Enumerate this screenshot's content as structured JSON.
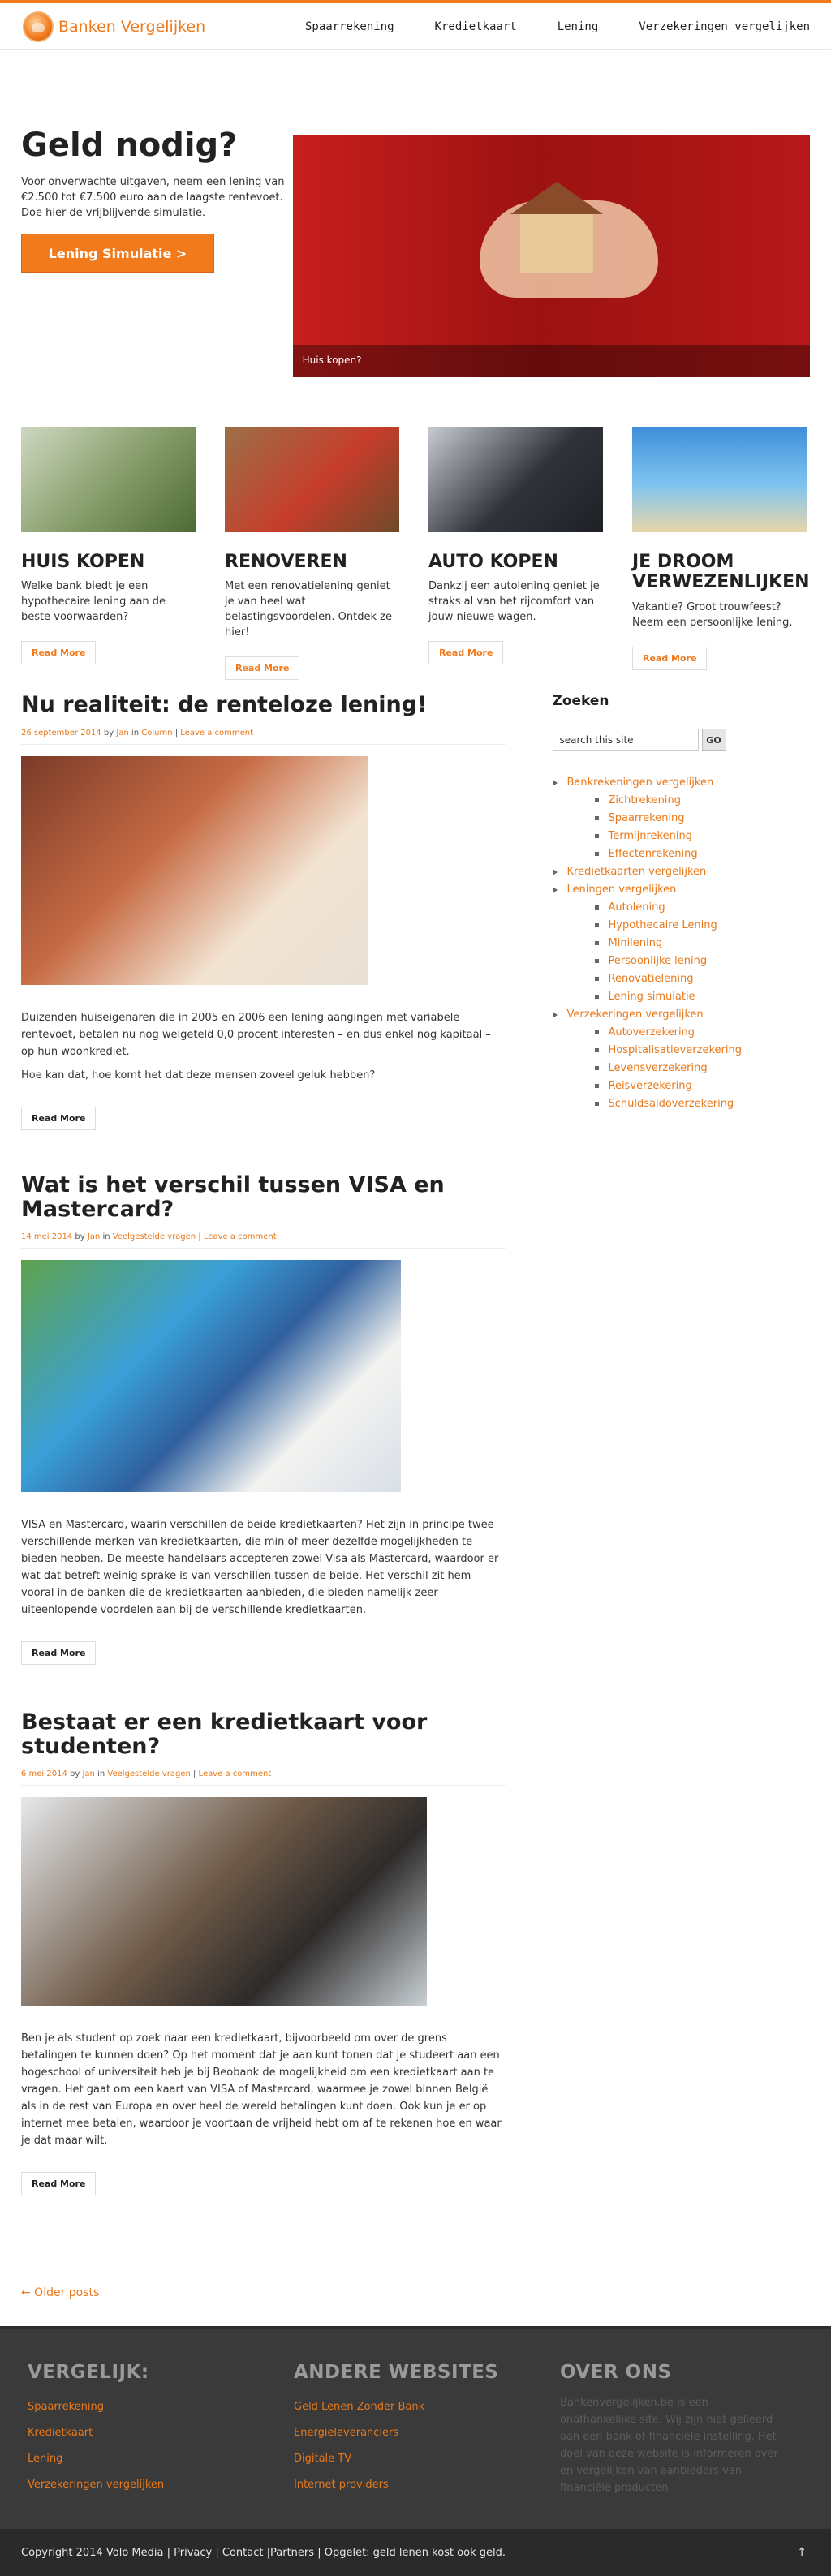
{
  "site": {
    "logo_text": "Banken Vergelijken",
    "nav": [
      "Spaarrekening",
      "Kredietkaart",
      "Lening",
      "Verzekeringen vergelijken"
    ]
  },
  "hero": {
    "title": "Geld nodig?",
    "text": "Voor onverwachte uitgaven, neem een lening van €2.500 tot €7.500 euro aan de laagste rentevoet. Doe hier de vrijblijvende simulatie.",
    "button": "Lening Simulatie >",
    "image_caption": "Huis kopen?"
  },
  "features": [
    {
      "title": "HUIS KOPEN",
      "text": "Welke bank biedt je een hypothecaire lening aan de beste voorwaarden?",
      "button": "Read More"
    },
    {
      "title": "RENOVEREN",
      "text": "Met een renovatielening geniet je van heel wat belastingsvoordelen. Ontdek ze hier!",
      "button": "Read More"
    },
    {
      "title": "AUTO KOPEN",
      "text": "Dankzij een autolening geniet je straks al van het rijcomfort van jouw nieuwe wagen.",
      "button": "Read More"
    },
    {
      "title": "JE DROOM VERWEZENLIJKEN",
      "text": "Vakantie? Groot trouwfeest? Neem een persoonlijke lening.",
      "button": "Read More"
    }
  ],
  "posts": [
    {
      "title": "Nu realiteit: de renteloze lening!",
      "date": "26 september 2014",
      "by": "by",
      "author": "Jan",
      "in": "in",
      "category": "Column",
      "sep": "|",
      "comment": "Leave a comment",
      "paragraphs": [
        "Duizenden huiseigenaren die in 2005 en 2006 een lening aangingen met variabele rentevoet, betalen nu nog welgeteld 0,0 procent interesten – en dus enkel nog kapitaal – op hun woonkrediet.",
        "Hoe kan dat, hoe komt het dat deze mensen zoveel geluk hebben?"
      ],
      "button": "Read More"
    },
    {
      "title": "Wat is het verschil tussen VISA en Mastercard?",
      "date": "14 mei 2014",
      "by": "by",
      "author": "Jan",
      "in": "in",
      "category": "Veelgestelde vragen",
      "sep": "|",
      "comment": "Leave a comment",
      "paragraphs": [
        "VISA en Mastercard, waarin verschillen de beide kredietkaarten? Het zijn in principe twee verschillende merken van kredietkaarten, die min of meer dezelfde mogelijkheden te bieden hebben. De meeste handelaars accepteren zowel Visa als Mastercard, waardoor er wat dat betreft weinig sprake is van verschillen tussen de beide. Het verschil zit hem vooral in de banken die de kredietkaarten aanbieden, die bieden namelijk zeer uiteenlopende voordelen aan bij de verschillende kredietkaarten."
      ],
      "button": "Read More"
    },
    {
      "title": "Bestaat er een kredietkaart voor studenten?",
      "date": "6 mei 2014",
      "by": "by",
      "author": "Jan",
      "in": "in",
      "category": "Veelgestelde vragen",
      "sep": "|",
      "comment": "Leave a comment",
      "paragraphs": [
        "Ben je als student op zoek naar een kredietkaart, bijvoorbeeld om over de grens betalingen te kunnen doen? Op het moment dat je aan kunt tonen dat je studeert aan een hogeschool of universiteit heb je bij Beobank de mogelijkheid om een kredietkaart aan te vragen. Het gaat om een kaart van VISA of Mastercard, waarmee je zowel binnen België als in de rest van Europa en over heel de wereld betalingen kunt doen. Ook kun je er op internet mee betalen, waardoor je voortaan de vrijheid hebt om af te rekenen hoe en waar je dat maar wilt."
      ],
      "button": "Read More"
    }
  ],
  "older_posts": "← Older posts",
  "sidebar": {
    "search_title": "Zoeken",
    "search_value": "search this site",
    "search_button": "GO",
    "categories": [
      {
        "label": "Bankrekeningen vergelijken",
        "children": [
          "Zichtrekening",
          "Spaarrekening",
          "Termijnrekening",
          "Effectenrekening"
        ]
      },
      {
        "label": "Kredietkaarten vergelijken",
        "children": []
      },
      {
        "label": "Leningen vergelijken",
        "children": [
          "Autolening",
          "Hypothecaire Lening",
          "Minilening",
          "Persoonlijke lening",
          "Renovatielening",
          "Lening simulatie"
        ]
      },
      {
        "label": "Verzekeringen vergelijken",
        "children": [
          "Autoverzekering",
          "Hospitalisatieverzekering",
          "Levensverzekering",
          "Reisverzekering",
          "Schuldsaldoverzekering"
        ]
      }
    ]
  },
  "footer": {
    "col1": {
      "title": "VERGELIJK:",
      "links": [
        "Spaarrekening",
        "Kredietkaart",
        "Lening",
        "Verzekeringen vergelijken"
      ]
    },
    "col2": {
      "title": "ANDERE WEBSITES",
      "links": [
        "Geld Lenen Zonder Bank",
        "Energieleveranciers",
        "Digitale TV",
        "Internet providers"
      ]
    },
    "col3": {
      "title": "OVER ONS",
      "text": "Bankenvergelijken.be is een onafhankelijke site. Wij zijn niet gelieerd aan een bank of financiële instelling. Het doel van deze website is informeren over en vergelijken van aanbieders van financiële producten."
    }
  },
  "bottom": {
    "copyright": "Copyright 2014",
    "company": "Volo Media",
    "sep1": "|",
    "privacy": "Privacy",
    "sep2": "|",
    "contact": "Contact",
    "sep3": "|",
    "partners": "Partners",
    "sep4": "|",
    "warning": "Opgelet: geld lenen kost ook geld.",
    "up": "↑"
  },
  "colors": {
    "accent": "#f07a1c",
    "footer_bg": "#3a3a3a",
    "bottom_bg": "#2a2a2a"
  }
}
